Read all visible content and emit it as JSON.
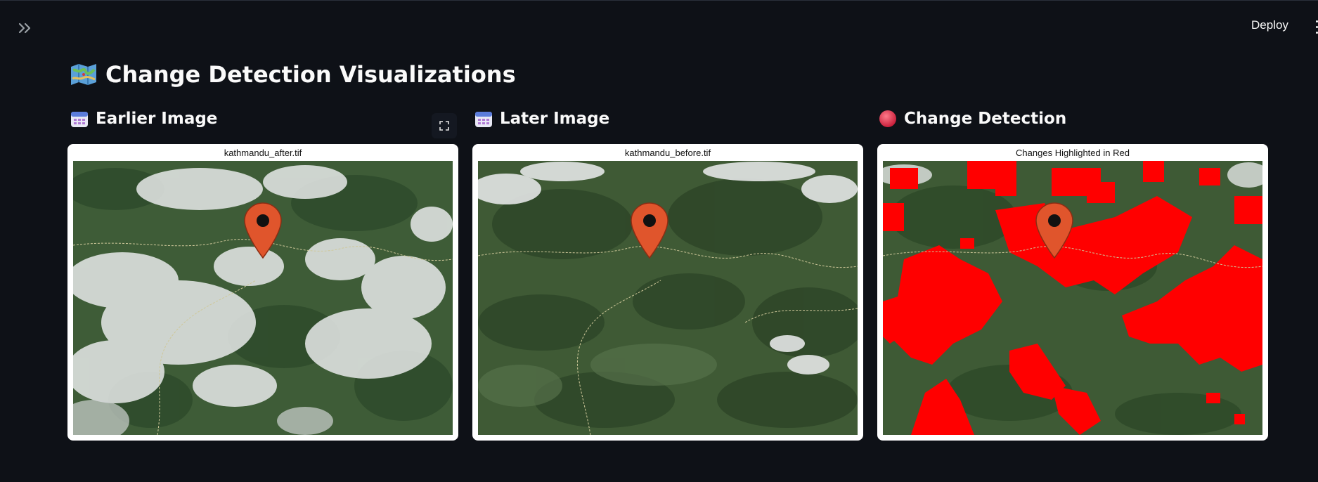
{
  "header": {
    "deploy_label": "Deploy"
  },
  "page": {
    "title": "Change Detection Visualizations",
    "title_icon": "map-icon"
  },
  "columns": [
    {
      "header": "Earlier Image",
      "icon": "calendar-icon",
      "caption": "kathmandu_after.tif"
    },
    {
      "header": "Later Image",
      "icon": "calendar-icon",
      "caption": "kathmandu_before.tif"
    },
    {
      "header": "Change Detection",
      "icon": "red-circle-icon",
      "caption": "Changes Highlighted in Red"
    }
  ],
  "colors": {
    "background": "#0e1117",
    "card": "#ffffff",
    "change_highlight": "#ff0000",
    "marker": "#e0552c"
  }
}
